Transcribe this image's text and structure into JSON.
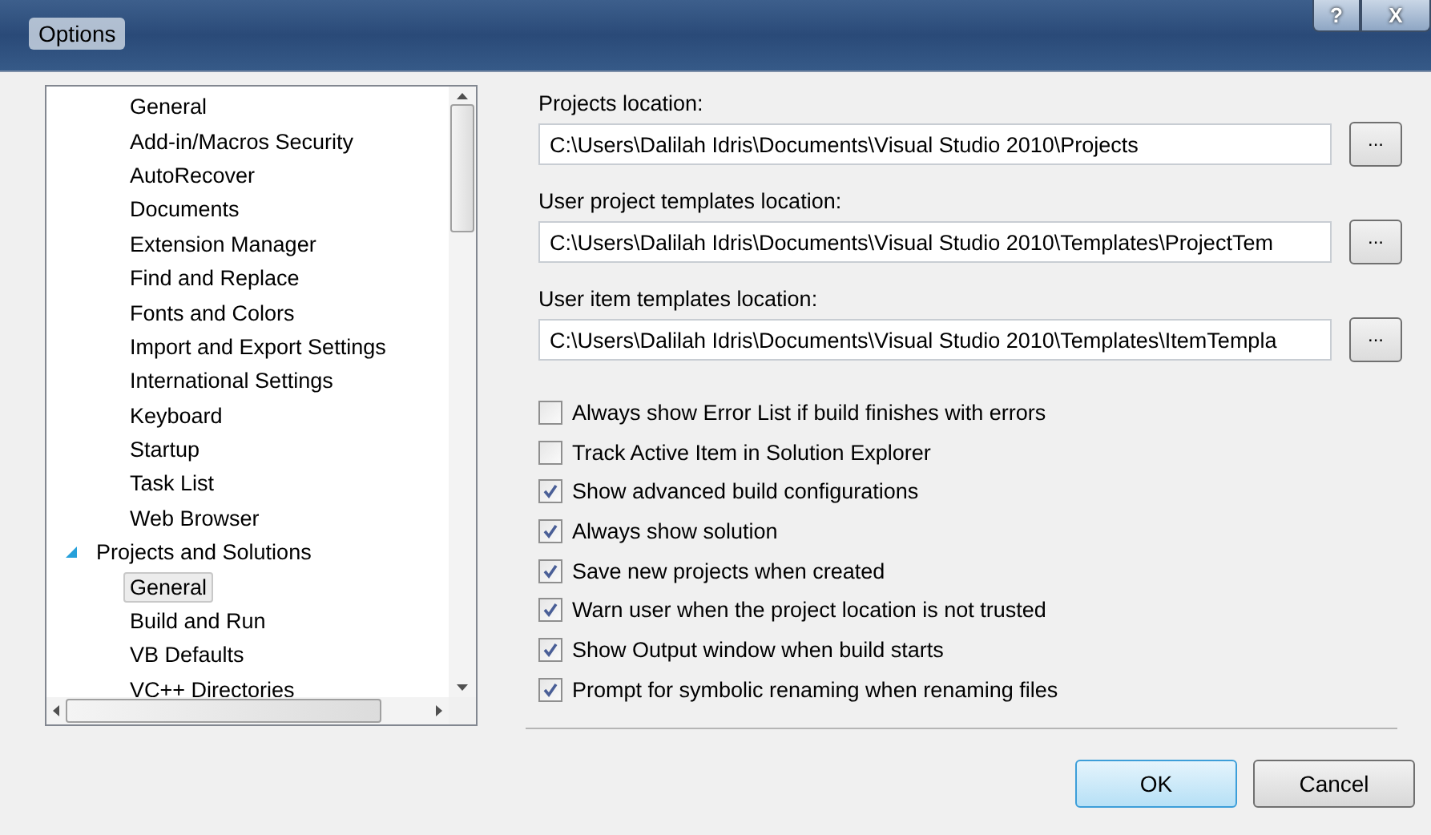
{
  "window": {
    "title": "Options",
    "buttons": [
      {
        "kind": "help",
        "label": "?"
      },
      {
        "kind": "close",
        "label": "X"
      }
    ]
  },
  "tree": {
    "items": [
      {
        "children": [
          {
            "label": "General",
            "selected": false
          },
          {
            "label": "Add-in/Macros Security",
            "selected": false
          },
          {
            "label": "AutoRecover",
            "selected": false
          },
          {
            "label": "Documents",
            "selected": false
          },
          {
            "label": "Extension Manager",
            "selected": false
          },
          {
            "label": "Find and Replace",
            "selected": false
          },
          {
            "label": "Fonts and Colors",
            "selected": false
          },
          {
            "label": "Import and Export Settings",
            "selected": false
          },
          {
            "label": "International Settings",
            "selected": false
          },
          {
            "label": "Keyboard",
            "selected": false
          },
          {
            "label": "Startup",
            "selected": false
          },
          {
            "label": "Task List",
            "selected": false
          },
          {
            "label": "Web Browser",
            "selected": false
          }
        ]
      },
      {
        "label": "Projects and Solutions",
        "expanded": true,
        "selected": false,
        "children": [
          {
            "label": "General",
            "selected": true
          },
          {
            "label": "Build and Run",
            "selected": false
          },
          {
            "label": "VB Defaults",
            "selected": false
          },
          {
            "label": "VC++ Directories",
            "selected": false
          }
        ]
      }
    ]
  },
  "locations": [
    {
      "label": "Projects location:",
      "value": "C:\\Users\\Dalilah Idris\\Documents\\Visual Studio 2010\\Projects",
      "button": "..."
    },
    {
      "label": "User project templates location:",
      "value": "C:\\Users\\Dalilah Idris\\Documents\\Visual Studio 2010\\Templates\\ProjectTem",
      "button": "..."
    },
    {
      "label": "User item templates location:",
      "value": "C:\\Users\\Dalilah Idris\\Documents\\Visual Studio 2010\\Templates\\ItemTempla",
      "button": "..."
    }
  ],
  "options": [
    {
      "label": "Always show Error List if build finishes with errors",
      "checked": false
    },
    {
      "label": "Track Active Item in Solution Explorer",
      "checked": false
    },
    {
      "label": "Show advanced build configurations",
      "checked": true
    },
    {
      "label": "Always show solution",
      "checked": true
    },
    {
      "label": "Save new projects when created",
      "checked": true
    },
    {
      "label": "Warn user when the project location is not trusted",
      "checked": true
    },
    {
      "label": "Show Output window when build starts",
      "checked": true
    },
    {
      "label": "Prompt for symbolic renaming when renaming files",
      "checked": true
    }
  ],
  "buttons": [
    {
      "label": "OK",
      "default": true
    },
    {
      "label": "Cancel",
      "default": false
    }
  ]
}
